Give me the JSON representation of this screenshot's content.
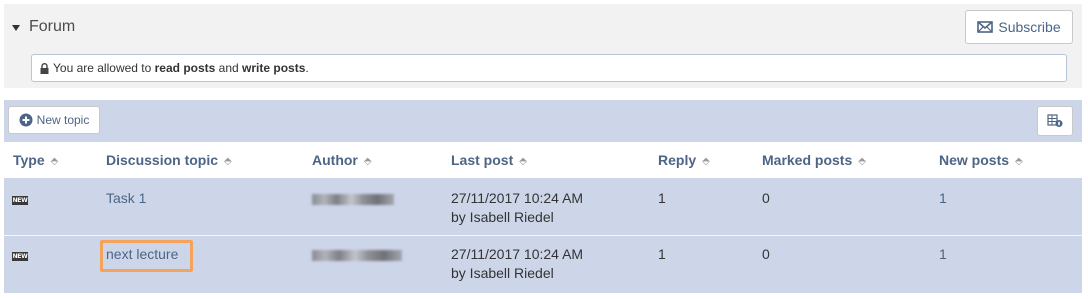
{
  "forum": {
    "title": "Forum",
    "subscribe_label": "Subscribe",
    "permission_prefix": "You are allowed to ",
    "permission_read": "read posts",
    "permission_and": " and ",
    "permission_write": "write posts",
    "permission_suffix": "."
  },
  "toolbar": {
    "new_topic_label": "New topic"
  },
  "table": {
    "headers": {
      "type": "Type",
      "topic": "Discussion topic",
      "author": "Author",
      "last_post": "Last post",
      "reply": "Reply",
      "marked": "Marked posts",
      "new_posts": "New posts"
    },
    "rows": [
      {
        "type_badge": "NEW",
        "topic": "Task 1",
        "author": "",
        "last_post_date": "27/11/2017 10:24 AM",
        "last_post_by": "by Isabell Riedel",
        "reply": "1",
        "marked": "0",
        "new_posts": "1"
      },
      {
        "type_badge": "NEW",
        "topic": "next lecture",
        "author": "",
        "last_post_date": "27/11/2017 10:24 AM",
        "last_post_by": "by Isabell Riedel",
        "reply": "1",
        "marked": "0",
        "new_posts": "1"
      }
    ]
  },
  "icons": {
    "collapse": "caret-down-icon",
    "subscribe": "envelope-icon",
    "permission": "lock-icon",
    "new_topic": "plus-circle-icon",
    "settings": "table-settings-icon",
    "sort": "sort-icon"
  },
  "colors": {
    "accent": "#4c6586",
    "table_bg": "#cdd6e9",
    "highlight": "#f5a35c"
  }
}
